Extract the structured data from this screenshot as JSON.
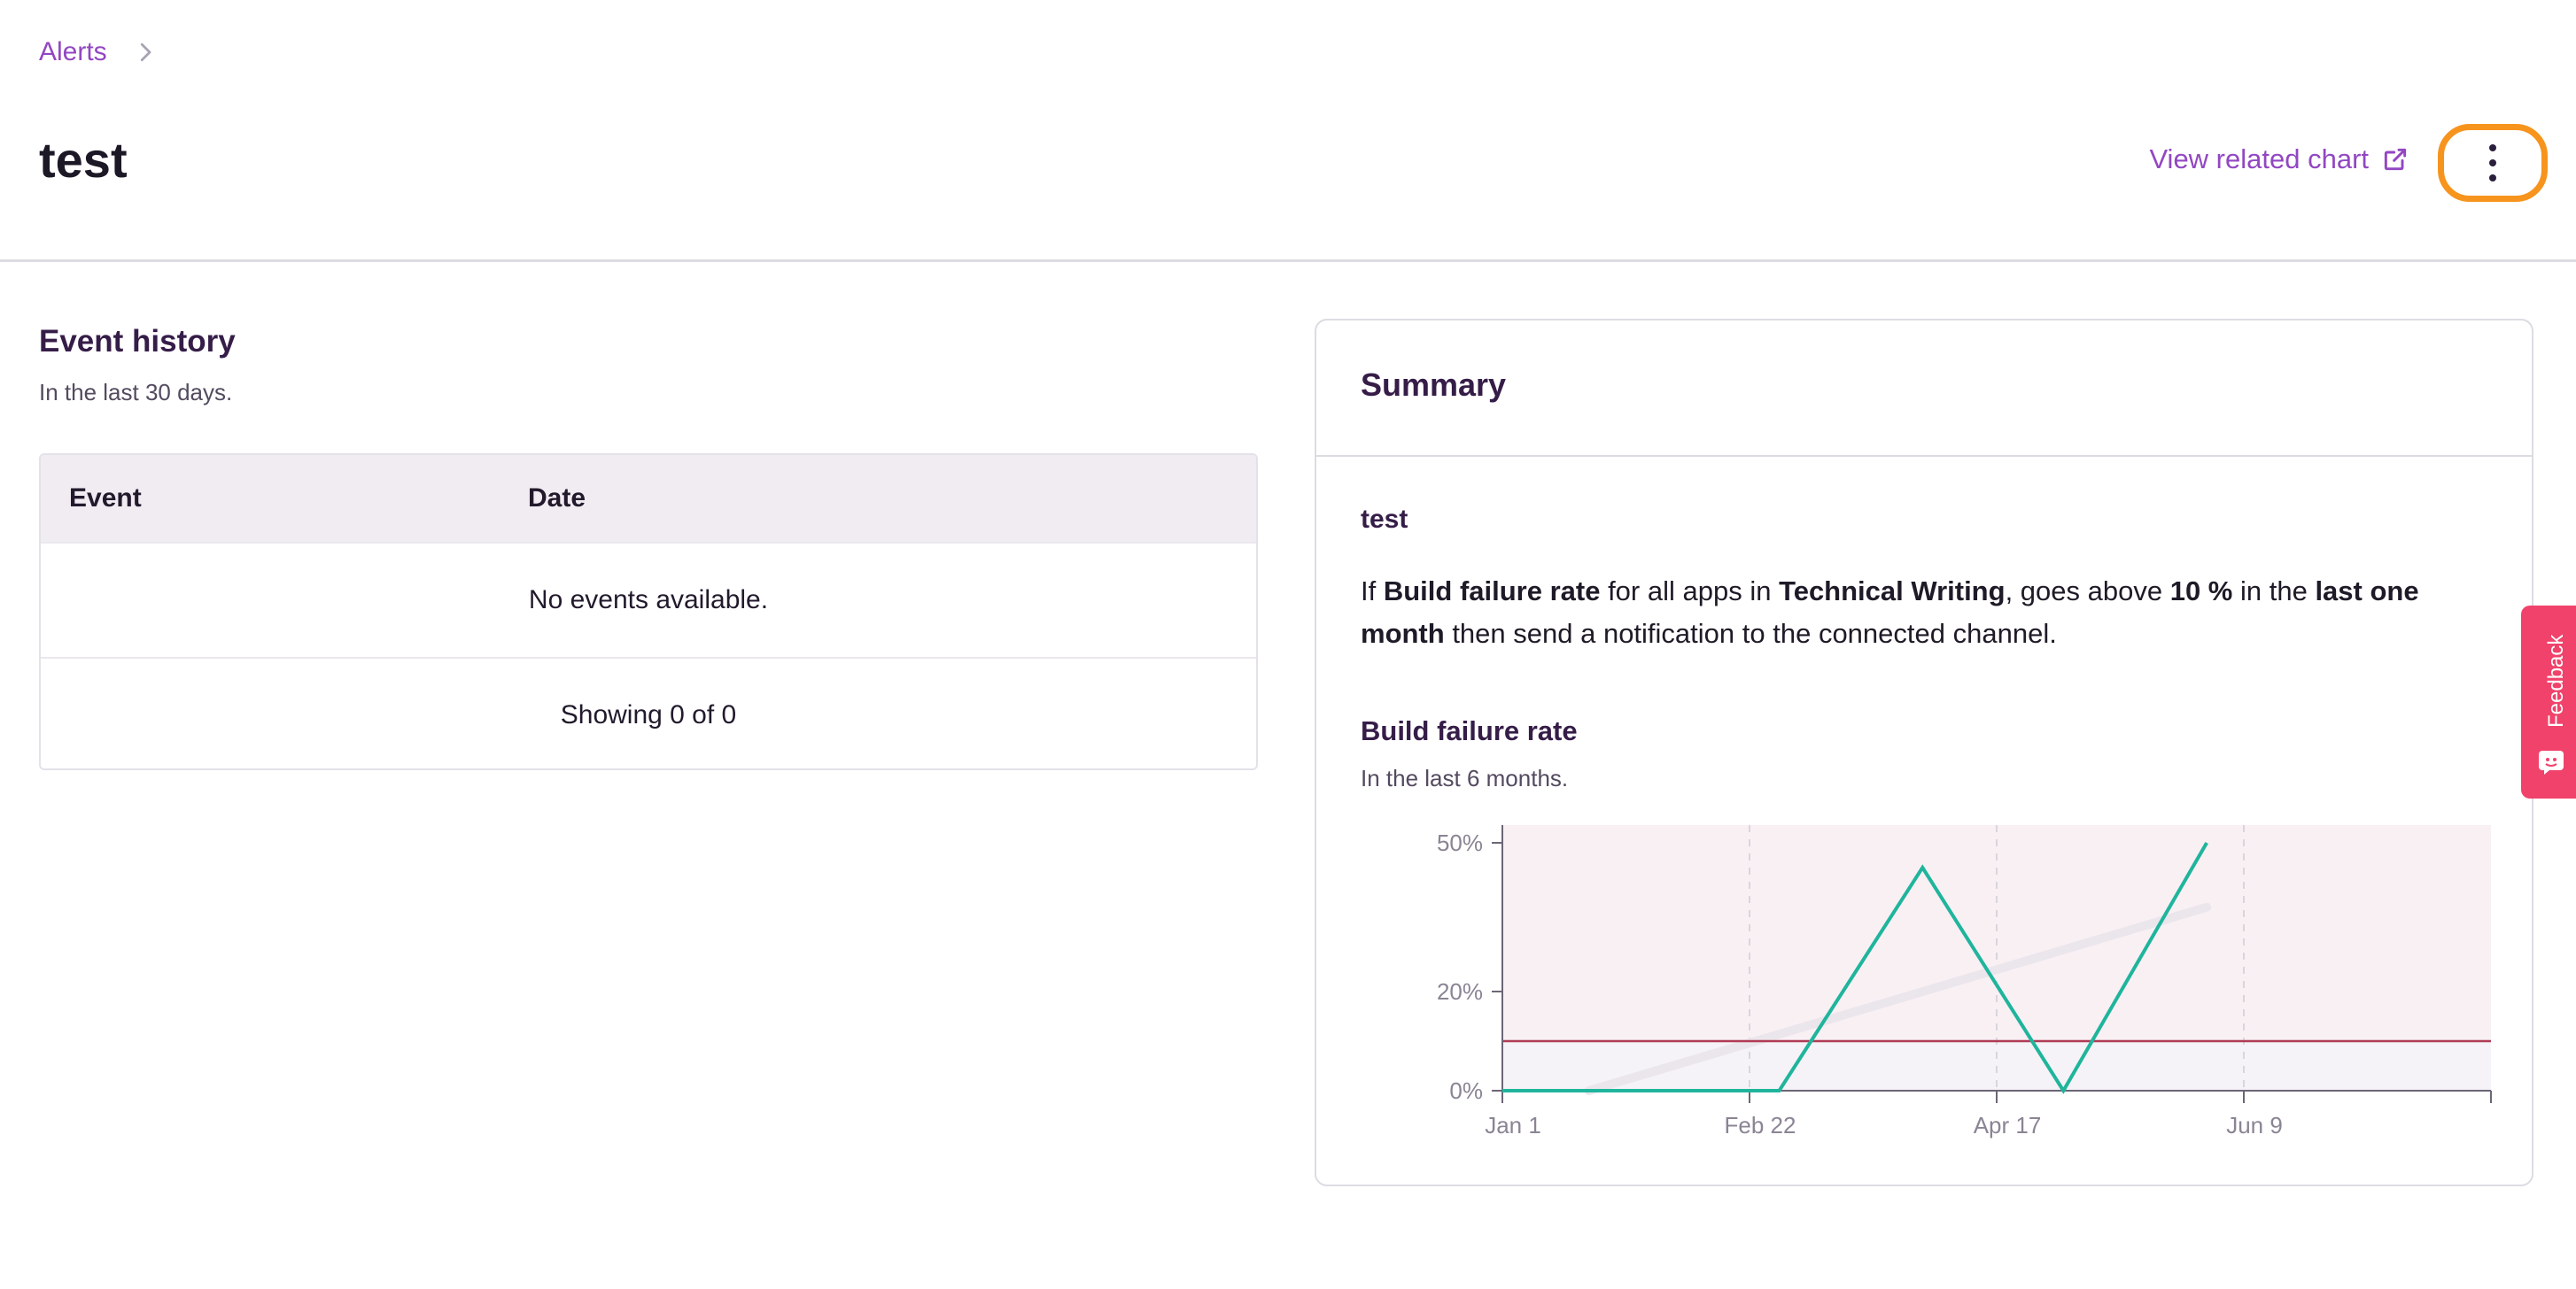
{
  "breadcrumb": {
    "parent": "Alerts"
  },
  "header": {
    "title": "test",
    "related_link": "View related chart"
  },
  "icons": {
    "chevron": "chevron-right-icon",
    "external": "external-link-icon",
    "more": "more-vertical-icon",
    "feedback": "feedback-icon"
  },
  "colors": {
    "accent": "#9247c2",
    "highlight": "#f7941d",
    "series": "#1fb59c",
    "threshold": "#b03b55",
    "feedback": "#f0426a"
  },
  "event_history": {
    "title": "Event history",
    "subtitle": "In the last 30 days.",
    "columns": [
      "Event",
      "Date"
    ],
    "empty_text": "No events available.",
    "footer": "Showing 0 of 0"
  },
  "summary": {
    "title": "Summary",
    "alert_name": "test",
    "desc": {
      "p1": "If ",
      "metric": "Build failure rate",
      "p2": " for all apps in ",
      "workspace": "Technical Writing",
      "p3": ", goes above ",
      "threshold": "10 %",
      "p4": " in the ",
      "period": "last one month",
      "p5": " then send a notification to the connected channel."
    },
    "chart_title": "Build failure rate",
    "chart_subtitle": "In the last 6 months."
  },
  "feedback": {
    "label": "Feedback"
  },
  "chart_data": {
    "type": "line",
    "x_ticks": [
      "Jan 1",
      "Feb 22",
      "Apr 17",
      "Jun 9"
    ],
    "y_ticks": [
      "0%",
      "20%",
      "50%"
    ],
    "series": [
      {
        "values": [
          {
            "t": 0,
            "y": 0
          },
          {
            "t": 1.12,
            "y": 0
          },
          {
            "t": 1.7,
            "y": 45
          },
          {
            "t": 2.27,
            "y": 0
          },
          {
            "t": 2.85,
            "y": 50
          }
        ]
      }
    ],
    "trend": [
      {
        "t": 0.35,
        "y": 0
      },
      {
        "t": 2.85,
        "y": 37
      }
    ],
    "threshold": 10,
    "ylim": [
      0,
      50
    ],
    "xlim": [
      0,
      4
    ],
    "grid": "vertical dashed"
  }
}
